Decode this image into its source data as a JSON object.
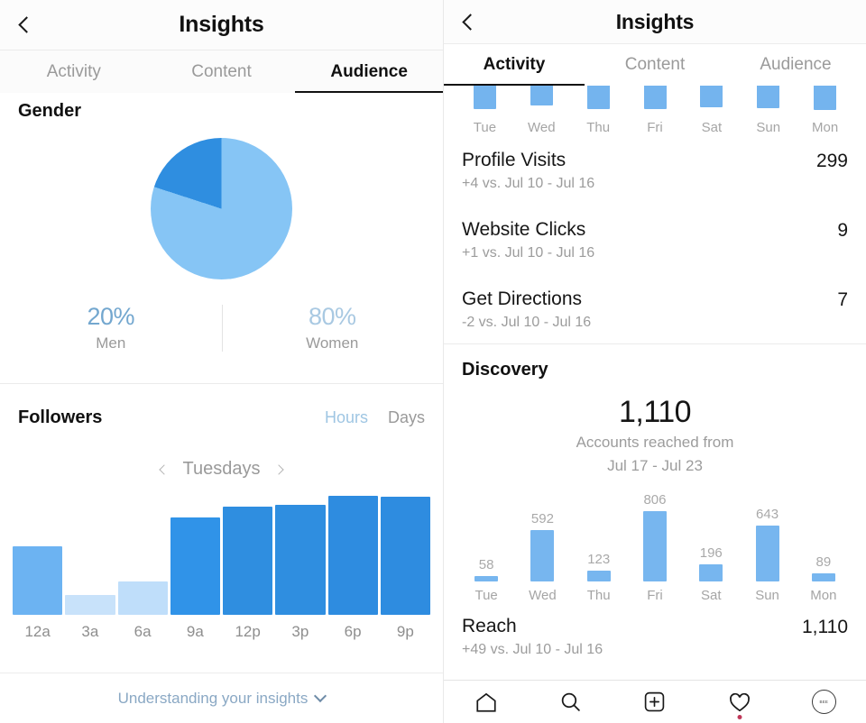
{
  "left_panel": {
    "nav": {
      "title": "Insights",
      "back_icon": "chevron-left-icon"
    },
    "tabs": [
      {
        "label": "Activity",
        "active": false
      },
      {
        "label": "Content",
        "active": false
      },
      {
        "label": "Audience",
        "active": true
      }
    ],
    "gender": {
      "title": "Gender",
      "men_pct": "20%",
      "men_label": "Men",
      "women_pct": "80%",
      "women_label": "Women"
    },
    "followers": {
      "title": "Followers",
      "segments": [
        {
          "label": "Hours",
          "active": true
        },
        {
          "label": "Days",
          "active": false
        }
      ],
      "day_nav": {
        "label": "Tuesdays",
        "prev_icon": "chevron-left-icon",
        "next_icon": "chevron-right-icon"
      }
    },
    "footer": {
      "label": "Understanding your insights",
      "icon": "chevron-down-icon"
    }
  },
  "right_panel": {
    "nav": {
      "title": "Insights",
      "back_icon": "chevron-left-icon"
    },
    "tabs": [
      {
        "label": "Activity",
        "active": true
      },
      {
        "label": "Content",
        "active": false
      },
      {
        "label": "Audience",
        "active": false
      }
    ],
    "metrics": [
      {
        "name": "Profile Visits",
        "sub": "+4 vs. Jul 10 - Jul 16",
        "value": "299"
      },
      {
        "name": "Website Clicks",
        "sub": "+1 vs. Jul 10 - Jul 16",
        "value": "9"
      },
      {
        "name": "Get Directions",
        "sub": "-2 vs. Jul 10 - Jul 16",
        "value": "7"
      }
    ],
    "discovery": {
      "title": "Discovery",
      "big_value": "1,110",
      "sub_line1": "Accounts reached from",
      "sub_line2": "Jul 17 - Jul 23"
    },
    "reach": {
      "name": "Reach",
      "sub": "+49 vs. Jul 10 - Jul 16",
      "value": "1,110"
    },
    "bottom_nav": [
      {
        "icon": "home-icon"
      },
      {
        "icon": "search-icon"
      },
      {
        "icon": "plus-square-icon"
      },
      {
        "icon": "heart-icon",
        "has_notification": true
      },
      {
        "icon": "profile-avatar-icon",
        "avatar_text": "BEE"
      }
    ]
  },
  "colors": {
    "men_slice": "#2f8ee0",
    "women_slice": "#86c5f5",
    "bar_blue": "#77b6ef",
    "bar_blue_dark": "#2f8ee0",
    "accent_text": "#9fc6e3"
  },
  "chart_data": [
    {
      "type": "pie",
      "title": "Gender",
      "categories": [
        "Men",
        "Women"
      ],
      "values": [
        20,
        80
      ],
      "labels": [
        "20%",
        "80%"
      ],
      "colors": [
        "#2f8ee0",
        "#86c5f5"
      ],
      "legend": "below"
    },
    {
      "type": "bar",
      "title": "Followers",
      "subtitle": "Tuesdays",
      "xlabel": "",
      "ylabel": "",
      "categories": [
        "12a",
        "3a",
        "6a",
        "9a",
        "12p",
        "3p",
        "6p",
        "9p"
      ],
      "values": [
        62,
        18,
        30,
        88,
        98,
        100,
        108,
        107
      ],
      "bar_colors": [
        "#6cb3f2",
        "#c8e2fa",
        "#bfdefa",
        "#3093e8",
        "#2f8ee0",
        "#2f8ee0",
        "#2e8ce0",
        "#2e8ce0"
      ],
      "grid": false,
      "legend": "none"
    },
    {
      "type": "bar",
      "title": "Discovery",
      "subtitle": "Accounts reached from Jul 17 - Jul 23",
      "categories": [
        "Tue",
        "Wed",
        "Thu",
        "Fri",
        "Sat",
        "Sun",
        "Mon"
      ],
      "values": [
        58,
        592,
        123,
        806,
        196,
        643,
        89
      ],
      "data_labels": [
        "58",
        "592",
        "123",
        "806",
        "196",
        "643",
        "89"
      ],
      "ylim": [
        0,
        806
      ],
      "bar_color": "#77b6ef",
      "grid": false,
      "legend": "none"
    },
    {
      "type": "bar",
      "title": "Activity (partially scrolled)",
      "categories": [
        "Tue",
        "Wed",
        "Thu",
        "Fri",
        "Sat",
        "Sun",
        "Mon"
      ],
      "values": [
        26,
        22,
        26,
        26,
        24,
        25,
        27
      ],
      "bar_color": "#74b4ee",
      "grid": false,
      "legend": "none",
      "note": "top of bars cut off by viewport"
    }
  ]
}
